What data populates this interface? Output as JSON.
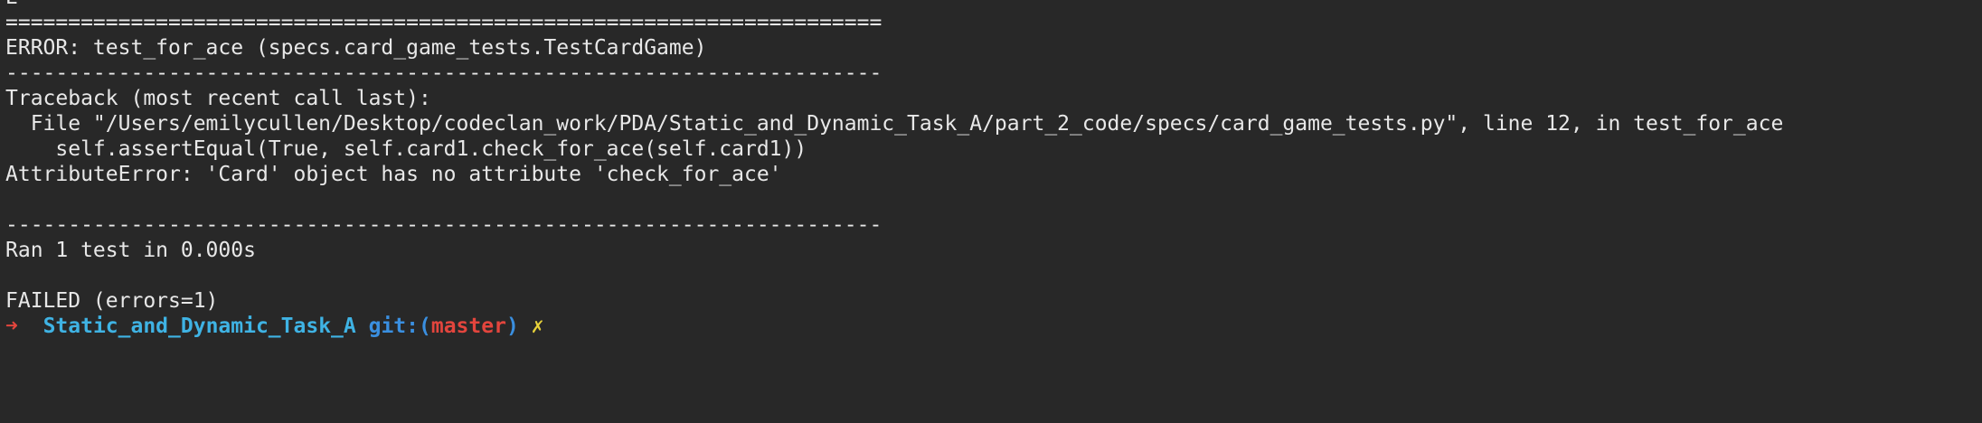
{
  "terminal": {
    "clipped_top_line": "E",
    "separator_double": "======================================================================",
    "error_line": "ERROR: test_for_ace (specs.card_game_tests.TestCardGame)",
    "separator_single": "----------------------------------------------------------------------",
    "traceback_header": "Traceback (most recent call last):",
    "traceback_file_line": "  File \"/Users/emilycullen/Desktop/codeclan_work/PDA/Static_and_Dynamic_Task_A/part_2_code/specs/card_game_tests.py\", line 12, in test_for_ace",
    "traceback_code_line": "    self.assertEqual(True, self.card1.check_for_ace(self.card1))",
    "exception_line": "AttributeError: 'Card' object has no attribute 'check_for_ace'",
    "blank": "",
    "separator_bottom": "----------------------------------------------------------------------",
    "ran_line": "Ran 1 test in 0.000s",
    "failed_line": "FAILED (errors=1)"
  },
  "prompt": {
    "arrow": "➜",
    "directory": "Static_and_Dynamic_Task_A",
    "git_label": "git:",
    "paren_open": "(",
    "branch": "master",
    "paren_close": ")",
    "dirty_marker": "✗"
  },
  "colors": {
    "background": "#282828",
    "text": "#e8e8e8",
    "arrow": "#e3453d",
    "directory": "#3fb3e4",
    "git_label": "#3a8fe0",
    "branch": "#e3453d",
    "dirty": "#e8d23a"
  }
}
